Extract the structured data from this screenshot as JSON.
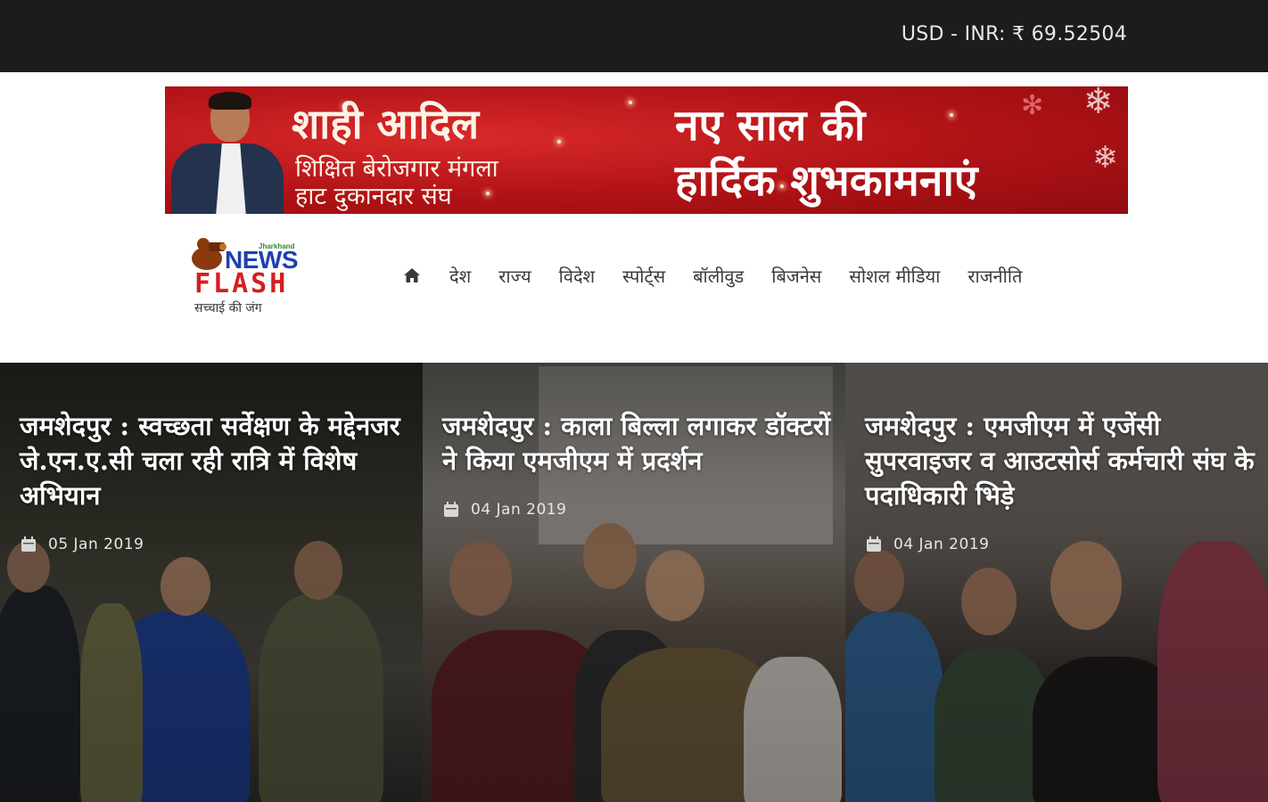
{
  "topbar": {
    "currency_text": "USD - INR: ₹ 69.52504"
  },
  "banner": {
    "name": "शाही आदिल",
    "subtitle_line1": "शिक्षित बेरोजगार मंगला",
    "subtitle_line2": "हाट दुकानदार संघ",
    "greeting_line1": "नए साल की",
    "greeting_line2": "हार्दिक शुभकामनाएं"
  },
  "logo": {
    "state_tag": "Jharkhand",
    "word1": "NEWS",
    "word2": "FLASH",
    "tagline": "सच्चाई की जंग"
  },
  "nav": {
    "home_icon": "home-icon",
    "items": [
      "देश",
      "राज्य",
      "विदेश",
      "स्पोर्ट्स",
      "बॉलीवुड",
      "बिजनेस",
      "सोशल मीडिया",
      "राजनीति"
    ]
  },
  "features": [
    {
      "title": "जमशेदपुर : स्वच्छता सर्वेक्षण के मद्देनजर जे.एन.ए.सी चला रही रात्रि में विशेष अभियान",
      "date": "05 Jan 2019"
    },
    {
      "title": "जमशेदपुर : काला बिल्ला लगाकर डॉक्टरों ने किया एमजीएम में प्रदर्शन",
      "date": "04 Jan 2019"
    },
    {
      "title": "जमशेदपुर : एमजीएम में एजेंसी सुपरवाइजर व आउटसोर्स कर्मचारी संघ के पदाधिकारी भिड़े",
      "date": "04 Jan 2019"
    }
  ],
  "colors": {
    "topbar": "#1c1c1c",
    "banner_red": "#b01216",
    "logo_blue": "#1f3fb0",
    "logo_red": "#d42020"
  }
}
